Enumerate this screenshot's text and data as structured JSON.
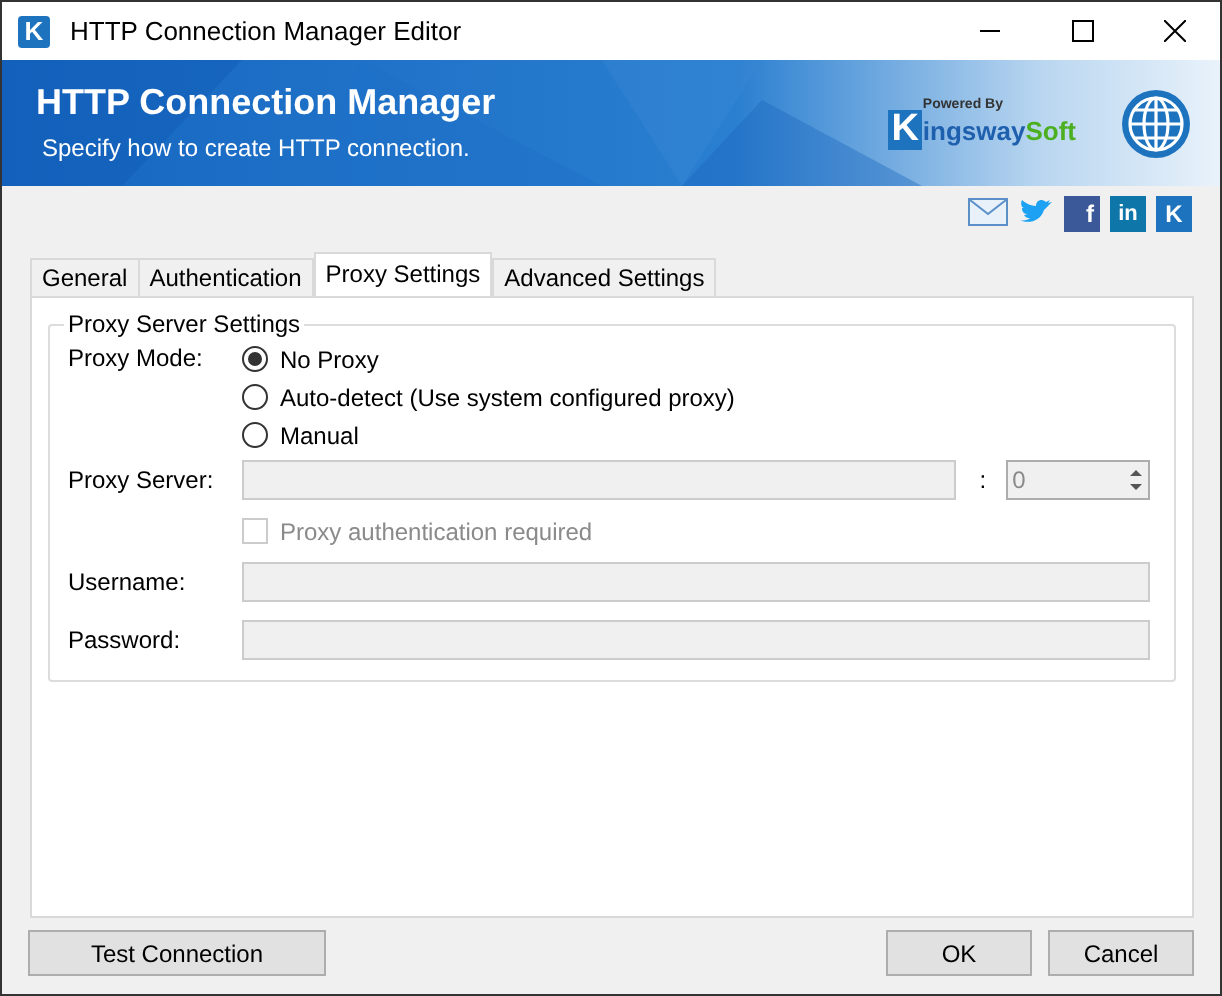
{
  "window": {
    "icon_letter": "K",
    "title": "HTTP Connection Manager Editor"
  },
  "banner": {
    "title": "HTTP Connection Manager",
    "subtitle": "Specify how to create HTTP connection.",
    "logo": {
      "powered_by": "Powered By",
      "initial": "K",
      "name_part1": "ingsway",
      "name_part2": "Soft"
    }
  },
  "social_links": [
    {
      "kind": "mail"
    },
    {
      "kind": "twitter"
    },
    {
      "kind": "facebook",
      "glyph": "f"
    },
    {
      "kind": "linkedin",
      "glyph": "in"
    },
    {
      "kind": "kingsway",
      "glyph": "K"
    }
  ],
  "tabs": [
    {
      "label": "General",
      "selected": false
    },
    {
      "label": "Authentication",
      "selected": false
    },
    {
      "label": "Proxy Settings",
      "selected": true
    },
    {
      "label": "Advanced Settings",
      "selected": false
    }
  ],
  "group": {
    "title": "Proxy Server Settings",
    "rows": [
      {
        "kind": "radio",
        "label": "Proxy Mode:",
        "options": [
          {
            "label": "No Proxy",
            "selected": true
          },
          {
            "label": "Auto-detect (Use system configured proxy)",
            "selected": false
          },
          {
            "label": "Manual",
            "selected": false
          }
        ]
      },
      {
        "kind": "server",
        "label": "Proxy Server:",
        "disabled": true,
        "separator": ":",
        "port": "0"
      },
      {
        "kind": "checkbox",
        "label": "Proxy authentication required",
        "checked": false,
        "disabled": true
      },
      {
        "kind": "text",
        "label": "Username:",
        "disabled": true
      },
      {
        "kind": "text",
        "label": "Password:",
        "disabled": true
      }
    ]
  },
  "buttons": {
    "left": [
      "Test Connection"
    ],
    "right": [
      "OK",
      "Cancel"
    ]
  }
}
